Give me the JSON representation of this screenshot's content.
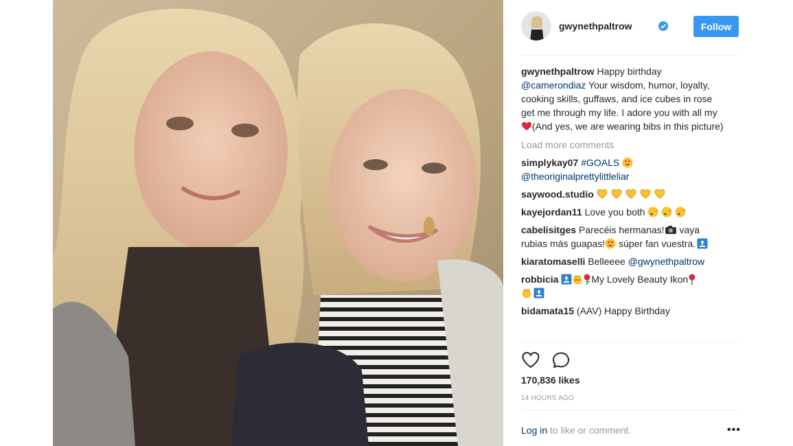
{
  "post": {
    "username": "gwynethpaltrow",
    "follow_label": "Follow",
    "caption": {
      "user": "gwynethpaltrow",
      "part1": " Happy birthday ",
      "mention": "@camerondiaz",
      "part2": " Your wisdom, humor, loyalty, cooking skills, guffaws, and ice cubes in rose get me through my life. I adore you with all my ",
      "part3": "(And yes, we are wearing bibs in this picture)"
    },
    "load_more": "Load more comments",
    "comments": [
      {
        "user": "simplykay07",
        "tag": "#GOALS",
        "mention": "@theoriginalprettylittleliar"
      },
      {
        "user": "saywood.studio"
      },
      {
        "user": "kayejordan11",
        "text": " Love you both "
      },
      {
        "user": "cabelisitges",
        "text1": " Parecéis hermanas!",
        "text2": " vaya rubias más guapas!",
        "text3": " súper fan vuestra."
      },
      {
        "user": "kiaratomaselli",
        "text": " Belleeee ",
        "mention": "@gwynethpaltrow"
      },
      {
        "user": "robbicia",
        "text": "My Lovely Beauty Ikon"
      },
      {
        "user": "bidamata15",
        "text": " (AAV) Happy Birthday"
      }
    ],
    "likes": "170,836 likes",
    "time": "14 HOURS AGO",
    "login_link": "Log in",
    "login_text": " to like or comment.",
    "more": "•••"
  },
  "icons": {
    "verified": "verified-badge-icon",
    "like": "heart-outline-icon",
    "comment": "comment-bubble-icon"
  },
  "colors": {
    "follow": "#3897f0",
    "link": "#003569",
    "muted": "#999999",
    "heart": "#ed4956"
  }
}
